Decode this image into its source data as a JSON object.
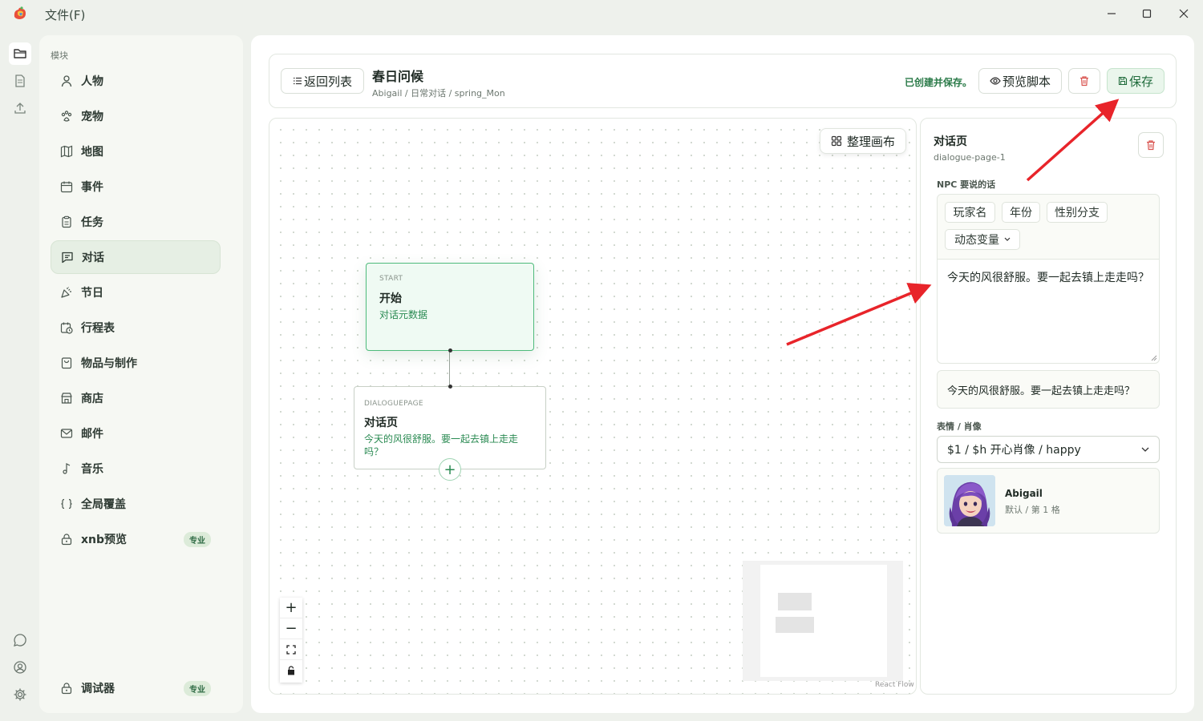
{
  "window": {
    "menu_file": "文件(F)",
    "icons": [
      "app-logo",
      "minimize-icon",
      "maximize-icon",
      "close-icon"
    ]
  },
  "rail": {
    "icons": [
      "folder-icon",
      "document-icon",
      "upload-icon",
      "chat-icon",
      "user-icon",
      "gear-icon"
    ]
  },
  "sidebar": {
    "heading": "模块",
    "items": [
      {
        "label": "人物",
        "icon": "person-icon"
      },
      {
        "label": "宠物",
        "icon": "paw-icon"
      },
      {
        "label": "地图",
        "icon": "map-icon"
      },
      {
        "label": "事件",
        "icon": "calendar-icon"
      },
      {
        "label": "任务",
        "icon": "clipboard-icon"
      },
      {
        "label": "对话",
        "icon": "message-icon",
        "active": true
      },
      {
        "label": "节日",
        "icon": "party-icon"
      },
      {
        "label": "行程表",
        "icon": "schedule-icon"
      },
      {
        "label": "物品与制作",
        "icon": "bag-icon"
      },
      {
        "label": "商店",
        "icon": "store-icon"
      },
      {
        "label": "邮件",
        "icon": "mail-icon"
      },
      {
        "label": "音乐",
        "icon": "music-icon"
      },
      {
        "label": "全局覆盖",
        "icon": "braces-icon"
      },
      {
        "label": "xnb预览",
        "icon": "lock-icon",
        "badge": "专业"
      }
    ],
    "bottom_item": {
      "label": "调试器",
      "icon": "lock-icon",
      "badge": "专业"
    }
  },
  "header": {
    "back_label": "返回列表",
    "title": "春日问候",
    "breadcrumb": "Abigail / 日常对话 / spring_Mon",
    "status": "已创建并保存。",
    "preview_label": "预览脚本",
    "save_label": "保存"
  },
  "canvas": {
    "tidy_label": "整理画布",
    "attribution": "React Flow",
    "nodes": [
      {
        "type": "START",
        "title": "开始",
        "subtitle": "对话元数据"
      },
      {
        "type": "DIALOGUEPAGE",
        "title": "对话页",
        "subtitle": "今天的风很舒服。要一起去镇上走走吗？"
      }
    ],
    "add_symbol": "+",
    "controls": {
      "zoom_in": "+",
      "zoom_out": "−"
    }
  },
  "inspector": {
    "title": "对话页",
    "id": "dialogue-page-1",
    "npc_label": "NPC 要说的话",
    "chips": [
      "玩家名",
      "年份",
      "性别分支"
    ],
    "dynamic_var": "动态变量",
    "text_value": "今天的风很舒服。要一起去镇上走走吗？",
    "preview_text": "今天的风很舒服。要一起去镇上走走吗？",
    "expression_label": "表情 / 肖像",
    "expression_value": "$1 / $h 开心肖像 / happy",
    "portrait_name": "Abigail",
    "portrait_sub": "默认 / 第 1 格"
  },
  "colors": {
    "accent": "#2a8a52",
    "save_bg": "#eaf6ec",
    "delete": "#d9534f",
    "annotation_arrow": "#e8242a"
  }
}
